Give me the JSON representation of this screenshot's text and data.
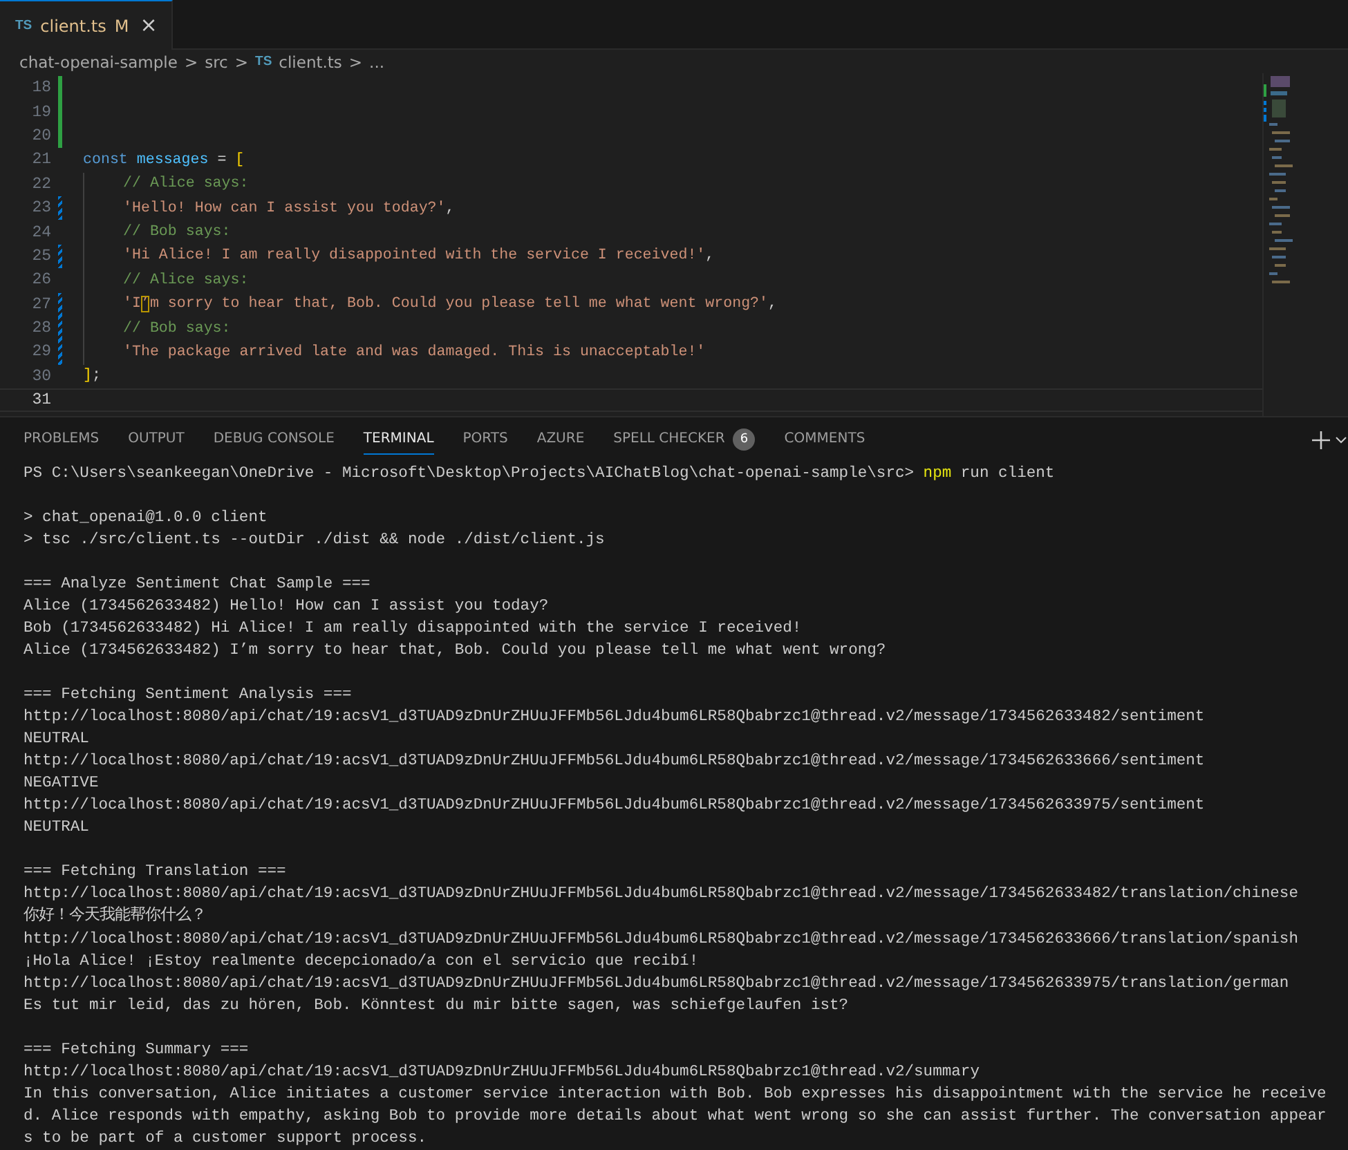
{
  "editor_tab": {
    "lang": "TS",
    "name": "client.ts",
    "badge": "M",
    "close": "×",
    "selected": true
  },
  "breadcrumb": {
    "items": [
      {
        "label": "chat-openai-sample"
      },
      {
        "label": "src"
      },
      {
        "label": "client.ts",
        "lang": "TS"
      },
      {
        "label": "..."
      }
    ],
    "separator": ">"
  },
  "code_lines": [
    {
      "number": "18",
      "added": true,
      "modified": false,
      "current": false,
      "indented": false
    },
    {
      "number": "19",
      "added": true,
      "modified": false,
      "current": false,
      "indented": false
    },
    {
      "number": "20",
      "added": true,
      "modified": false,
      "current": false,
      "indented": false
    },
    {
      "number": "21",
      "added": false,
      "modified": false,
      "current": false,
      "indented": false,
      "tokens": [
        {
          "kind": "keyword",
          "text": "const"
        },
        {
          "kind": "variable",
          "text": "messages"
        },
        {
          "kind": "operator",
          "text": "="
        },
        {
          "kind": "bracket",
          "text": "["
        }
      ]
    },
    {
      "number": "22",
      "added": false,
      "modified": false,
      "current": false,
      "indented": true,
      "tokens": [
        {
          "kind": "comment",
          "text": "// Alice says:"
        }
      ]
    },
    {
      "number": "23",
      "added": false,
      "modified": true,
      "current": false,
      "indented": true,
      "tokens": [
        {
          "kind": "string",
          "text": "'Hello! How can I assist you today?'"
        },
        {
          "kind": "plain",
          "text": ","
        }
      ]
    },
    {
      "number": "24",
      "added": false,
      "modified": false,
      "current": false,
      "indented": true,
      "tokens": [
        {
          "kind": "comment",
          "text": "// Bob says:"
        }
      ]
    },
    {
      "number": "25",
      "added": false,
      "modified": true,
      "current": false,
      "indented": true,
      "tokens": [
        {
          "kind": "string",
          "text": "'Hi Alice! I am really disappointed with the service I received!'"
        },
        {
          "kind": "plain",
          "text": ","
        }
      ]
    },
    {
      "number": "26",
      "added": false,
      "modified": false,
      "current": false,
      "indented": true,
      "tokens": [
        {
          "kind": "comment",
          "text": "// Alice says:"
        }
      ]
    },
    {
      "number": "27",
      "added": false,
      "modified": true,
      "current": false,
      "indented": true,
      "tokens": [
        {
          "kind": "string",
          "text": "'I"
        },
        {
          "kind": "flagged",
          "text": "’"
        },
        {
          "kind": "string",
          "text": "m sorry to hear that, Bob. Could you please tell me what went wrong?'"
        },
        {
          "kind": "plain",
          "text": ","
        }
      ]
    },
    {
      "number": "28",
      "added": false,
      "modified": true,
      "current": false,
      "indented": true,
      "tokens": [
        {
          "kind": "comment",
          "text": "// Bob says:"
        }
      ]
    },
    {
      "number": "29",
      "added": false,
      "modified": true,
      "current": false,
      "indented": true,
      "tokens": [
        {
          "kind": "string",
          "text": "'The package arrived late and was damaged. This is unacceptable!'"
        }
      ]
    },
    {
      "number": "30",
      "added": false,
      "modified": false,
      "current": false,
      "indented": false,
      "tokens": [
        {
          "kind": "bracket",
          "text": "]"
        },
        {
          "kind": "plain",
          "text": ";"
        }
      ]
    },
    {
      "number": "31",
      "added": false,
      "modified": false,
      "current": true,
      "indented": false
    }
  ],
  "panel_tabs": [
    {
      "label": "PROBLEMS",
      "selected": false
    },
    {
      "label": "OUTPUT",
      "selected": false
    },
    {
      "label": "DEBUG CONSOLE",
      "selected": false
    },
    {
      "label": "TERMINAL",
      "selected": true
    },
    {
      "label": "PORTS",
      "selected": false
    },
    {
      "label": "AZURE",
      "selected": false
    },
    {
      "label": "SPELL CHECKER",
      "selected": false,
      "count": "6"
    },
    {
      "label": "COMMENTS",
      "selected": false
    }
  ],
  "terminal_lines": [
    {
      "kind": "prompt",
      "text": "PS C:\\Users\\seankeegan\\OneDrive - Microsoft\\Desktop\\Projects\\AIChatBlog\\chat-openai-sample\\src>",
      "command": "npm",
      "args": "run client"
    },
    {
      "kind": "blank"
    },
    {
      "kind": "output",
      "text": "> chat_openai@1.0.0 client"
    },
    {
      "kind": "output",
      "text": "> tsc ./src/client.ts --outDir ./dist && node ./dist/client.js"
    },
    {
      "kind": "blank"
    },
    {
      "kind": "output",
      "text": "=== Analyze Sentiment Chat Sample ==="
    },
    {
      "kind": "output",
      "text": "Alice (1734562633482) Hello! How can I assist you today?"
    },
    {
      "kind": "output",
      "text": "Bob (1734562633482) Hi Alice! I am really disappointed with the service I received!"
    },
    {
      "kind": "output",
      "text": "Alice (1734562633482) I’m sorry to hear that, Bob. Could you please tell me what went wrong?"
    },
    {
      "kind": "blank"
    },
    {
      "kind": "output",
      "text": "=== Fetching Sentiment Analysis ==="
    },
    {
      "kind": "output",
      "text": "http://localhost:8080/api/chat/19:acsV1_d3TUAD9zDnUrZHUuJFFMb56LJdu4bum6LR58Qbabrzc1@thread.v2/message/1734562633482/sentiment"
    },
    {
      "kind": "output",
      "text": "NEUTRAL"
    },
    {
      "kind": "output",
      "text": "http://localhost:8080/api/chat/19:acsV1_d3TUAD9zDnUrZHUuJFFMb56LJdu4bum6LR58Qbabrzc1@thread.v2/message/1734562633666/sentiment"
    },
    {
      "kind": "output",
      "text": "NEGATIVE"
    },
    {
      "kind": "output",
      "text": "http://localhost:8080/api/chat/19:acsV1_d3TUAD9zDnUrZHUuJFFMb56LJdu4bum6LR58Qbabrzc1@thread.v2/message/1734562633975/sentiment"
    },
    {
      "kind": "output",
      "text": "NEUTRAL"
    },
    {
      "kind": "blank"
    },
    {
      "kind": "output",
      "text": "=== Fetching Translation ==="
    },
    {
      "kind": "output",
      "text": "http://localhost:8080/api/chat/19:acsV1_d3TUAD9zDnUrZHUuJFFMb56LJdu4bum6LR58Qbabrzc1@thread.v2/message/1734562633482/translation/chinese"
    },
    {
      "kind": "output",
      "text": "你好！今天我能帮你什么？"
    },
    {
      "kind": "output",
      "text": "http://localhost:8080/api/chat/19:acsV1_d3TUAD9zDnUrZHUuJFFMb56LJdu4bum6LR58Qbabrzc1@thread.v2/message/1734562633666/translation/spanish"
    },
    {
      "kind": "output",
      "text": "¡Hola Alice! ¡Estoy realmente decepcionado/a con el servicio que recibí!"
    },
    {
      "kind": "output",
      "text": "http://localhost:8080/api/chat/19:acsV1_d3TUAD9zDnUrZHUuJFFMb56LJdu4bum6LR58Qbabrzc1@thread.v2/message/1734562633975/translation/german"
    },
    {
      "kind": "output",
      "text": "Es tut mir leid, das zu hören, Bob. Könntest du mir bitte sagen, was schiefgelaufen ist?"
    },
    {
      "kind": "blank"
    },
    {
      "kind": "output",
      "text": "=== Fetching Summary ==="
    },
    {
      "kind": "output",
      "text": "http://localhost:8080/api/chat/19:acsV1_d3TUAD9zDnUrZHUuJFFMb56LJdu4bum6LR58Qbabrzc1@thread.v2/summary"
    },
    {
      "kind": "output",
      "text": "In this conversation, Alice initiates a customer service interaction with Bob. Bob expresses his disappointment with the service he receive"
    },
    {
      "kind": "output",
      "text": "d. Alice responds with empathy, asking Bob to provide more details about what went wrong so she can assist further. The conversation appear"
    },
    {
      "kind": "output",
      "text": "s to be part of a customer support process."
    }
  ]
}
